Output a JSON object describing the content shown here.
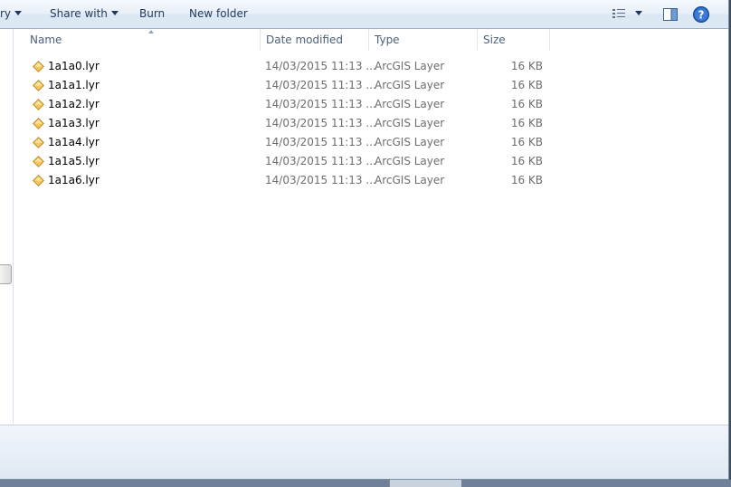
{
  "toolbar": {
    "library_partial": "ry",
    "share_with": "Share with",
    "burn": "Burn",
    "new_folder": "New folder"
  },
  "columns": {
    "name": "Name",
    "date_modified": "Date modified",
    "type": "Type",
    "size": "Size"
  },
  "files": [
    {
      "name": "1a1a0.lyr",
      "date": "14/03/2015 11:13 ...",
      "type": "ArcGIS Layer",
      "size": "16 KB"
    },
    {
      "name": "1a1a1.lyr",
      "date": "14/03/2015 11:13 ...",
      "type": "ArcGIS Layer",
      "size": "16 KB"
    },
    {
      "name": "1a1a2.lyr",
      "date": "14/03/2015 11:13 ...",
      "type": "ArcGIS Layer",
      "size": "16 KB"
    },
    {
      "name": "1a1a3.lyr",
      "date": "14/03/2015 11:13 ...",
      "type": "ArcGIS Layer",
      "size": "16 KB"
    },
    {
      "name": "1a1a4.lyr",
      "date": "14/03/2015 11:13 ...",
      "type": "ArcGIS Layer",
      "size": "16 KB"
    },
    {
      "name": "1a1a5.lyr",
      "date": "14/03/2015 11:13 ...",
      "type": "ArcGIS Layer",
      "size": "16 KB"
    },
    {
      "name": "1a1a6.lyr",
      "date": "14/03/2015 11:13 ...",
      "type": "ArcGIS Layer",
      "size": "16 KB"
    }
  ],
  "icons": {
    "file": "arcgis-layer-icon",
    "view": "view-options-icon",
    "preview": "preview-pane-icon",
    "help": "help-icon"
  },
  "colors": {
    "toolbar_text": "#1e395b",
    "layer_icon_fill": "#f7c75a",
    "layer_icon_stroke": "#b8861d",
    "help_blue": "#2a67c4"
  }
}
